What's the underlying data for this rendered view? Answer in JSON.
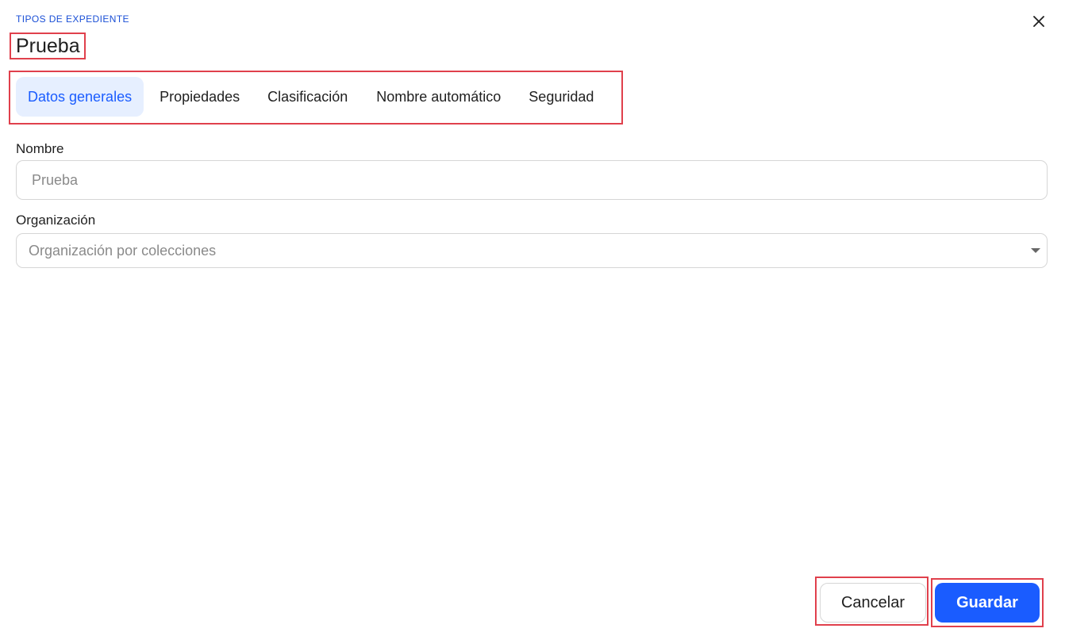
{
  "header": {
    "eyebrow": "TIPOS DE EXPEDIENTE",
    "title": "Prueba",
    "close_icon": "close-icon"
  },
  "tabs": [
    {
      "label": "Datos generales",
      "active": true
    },
    {
      "label": "Propiedades",
      "active": false
    },
    {
      "label": "Clasificación",
      "active": false
    },
    {
      "label": "Nombre automático",
      "active": false
    },
    {
      "label": "Seguridad",
      "active": false
    }
  ],
  "form": {
    "nombre": {
      "label": "Nombre",
      "placeholder": "Prueba"
    },
    "organizacion": {
      "label": "Organización",
      "value": "Organización por colecciones",
      "icon": "chevron-down-icon"
    }
  },
  "footer": {
    "cancel_label": "Cancelar",
    "save_label": "Guardar"
  },
  "colors": {
    "accent": "#1a5cff",
    "eyebrow": "#1a4fd6",
    "active_tab_bg": "#e6efff",
    "highlight_border": "#e0404c"
  }
}
